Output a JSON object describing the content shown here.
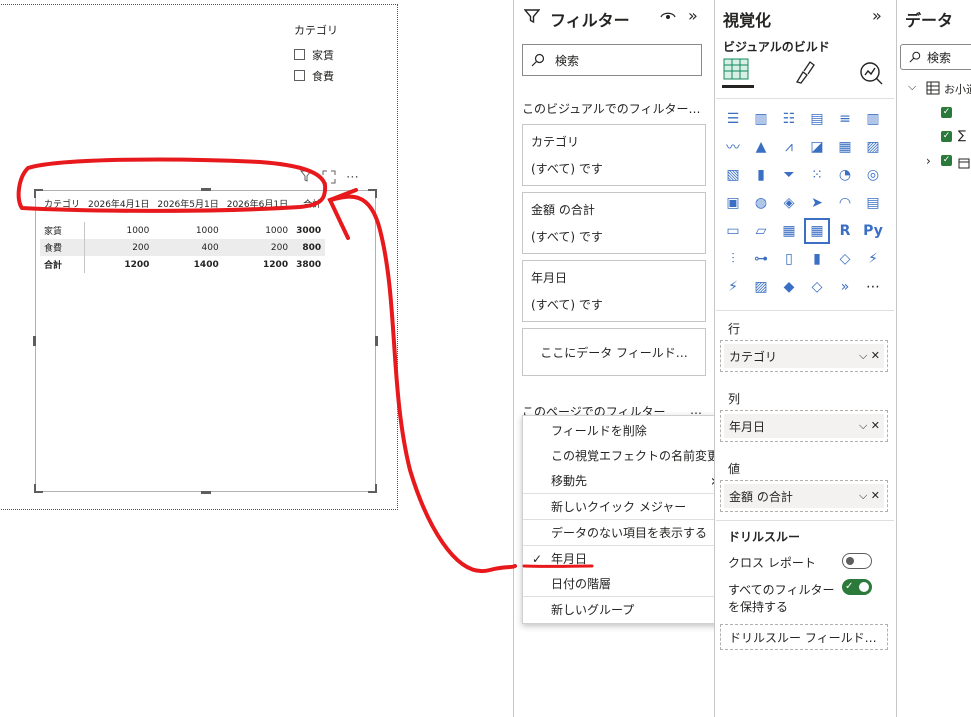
{
  "slicer": {
    "title": "カテゴリ",
    "options": [
      "家賃",
      "食費"
    ]
  },
  "visual_toolbar": {
    "filter_icon": "filter-icon",
    "focus_icon": "focus-mode-icon",
    "more": "⋯"
  },
  "matrix": {
    "headers": [
      "カテゴリ",
      "2026年4月1日",
      "2026年5月1日",
      "2026年6月1日",
      "合計"
    ],
    "rows": [
      [
        "家賃",
        "1000",
        "1000",
        "1000",
        "3000"
      ],
      [
        "食費",
        "200",
        "400",
        "200",
        "800"
      ],
      [
        "合計",
        "1200",
        "1400",
        "1200",
        "3800"
      ]
    ]
  },
  "filter_pane": {
    "title": "フィルター",
    "search_placeholder": "検索",
    "visual_section": "このビジュアルでのフィルター…",
    "cards": [
      {
        "field": "カテゴリ",
        "state": "(すべて) です"
      },
      {
        "field": "金額 の合計",
        "state": "(すべて) です"
      },
      {
        "field": "年月日",
        "state": "(すべて) です"
      }
    ],
    "drop_field": "ここにデータ フィールド…",
    "page_section": "このページでのフィルター",
    "page_more": "…"
  },
  "context_menu": {
    "items": [
      "フィールドを削除",
      "この視覚エフェクトの名前変更",
      "移動先",
      "新しいクイック メジャー",
      "データのない項目を表示する",
      "年月日",
      "日付の階層",
      "新しいグループ"
    ],
    "checked_item": "年月日",
    "check_glyph": "✓",
    "submenu_glyph": "›"
  },
  "viz_pane": {
    "title": "視覚化",
    "subtitle": "ビジュアルのビルド",
    "collapse": "»",
    "wells": [
      {
        "label": "行",
        "value": "カテゴリ"
      },
      {
        "label": "列",
        "value": "年月日"
      },
      {
        "label": "値",
        "value": "金額 の合計"
      }
    ],
    "drill_title": "ドリルスルー",
    "cross_report": "クロス レポート",
    "keep_filters_1": "すべてのフィルター",
    "keep_filters_2": "を保持する",
    "drill_field": "ドリルスルー フィールド…",
    "r_label": "R",
    "py_label": "Py",
    "more": "⋯",
    "cross_report_state": "off",
    "keep_filters_state": "on"
  },
  "data_pane": {
    "title": "データ",
    "search_placeholder": "検索",
    "table_name": "お小遣",
    "sigma": "∑"
  },
  "colors": {
    "accent": "#118dff",
    "annotation": "#e8191c",
    "toggle_on": "#2b7a3b"
  }
}
